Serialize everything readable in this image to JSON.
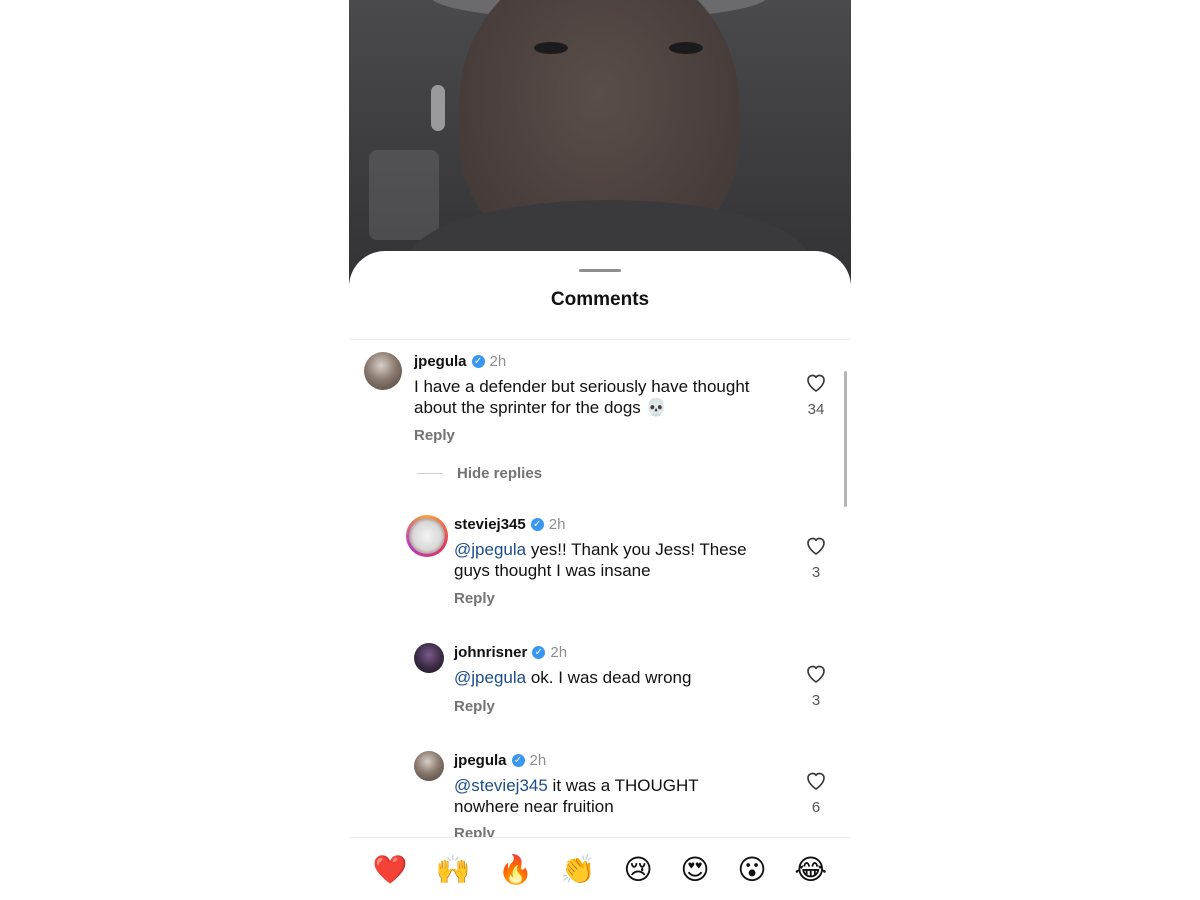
{
  "sheet": {
    "title": "Comments"
  },
  "thread": {
    "main": {
      "username": "jpegula",
      "time": "2h",
      "text": "I have a defender but seriously have thought about the sprinter for the dogs 💀",
      "reply_label": "Reply",
      "likes": "34"
    },
    "hide_replies_label": "Hide replies",
    "replies": [
      {
        "username": "steviej345",
        "time": "2h",
        "mention": "@jpegula",
        "text": " yes!! Thank you Jess! These guys thought I was insane",
        "reply_label": "Reply",
        "likes": "3"
      },
      {
        "username": "johnrisner",
        "time": "2h",
        "mention": "@jpegula",
        "text": " ok. I was dead wrong",
        "reply_label": "Reply",
        "likes": "3"
      },
      {
        "username": "jpegula",
        "time": "2h",
        "mention": "@steviej345",
        "text": " it was a THOUGHT nowhere near fruition",
        "reply_label": "Reply",
        "likes": "6"
      }
    ]
  },
  "emoji_bar": [
    "❤️",
    "🙌",
    "🔥",
    "👏",
    "😢",
    "😍",
    "😮",
    "😂"
  ],
  "colors": {
    "verified": "#3897f0",
    "mention": "#1d4e89",
    "muted": "#737373"
  }
}
